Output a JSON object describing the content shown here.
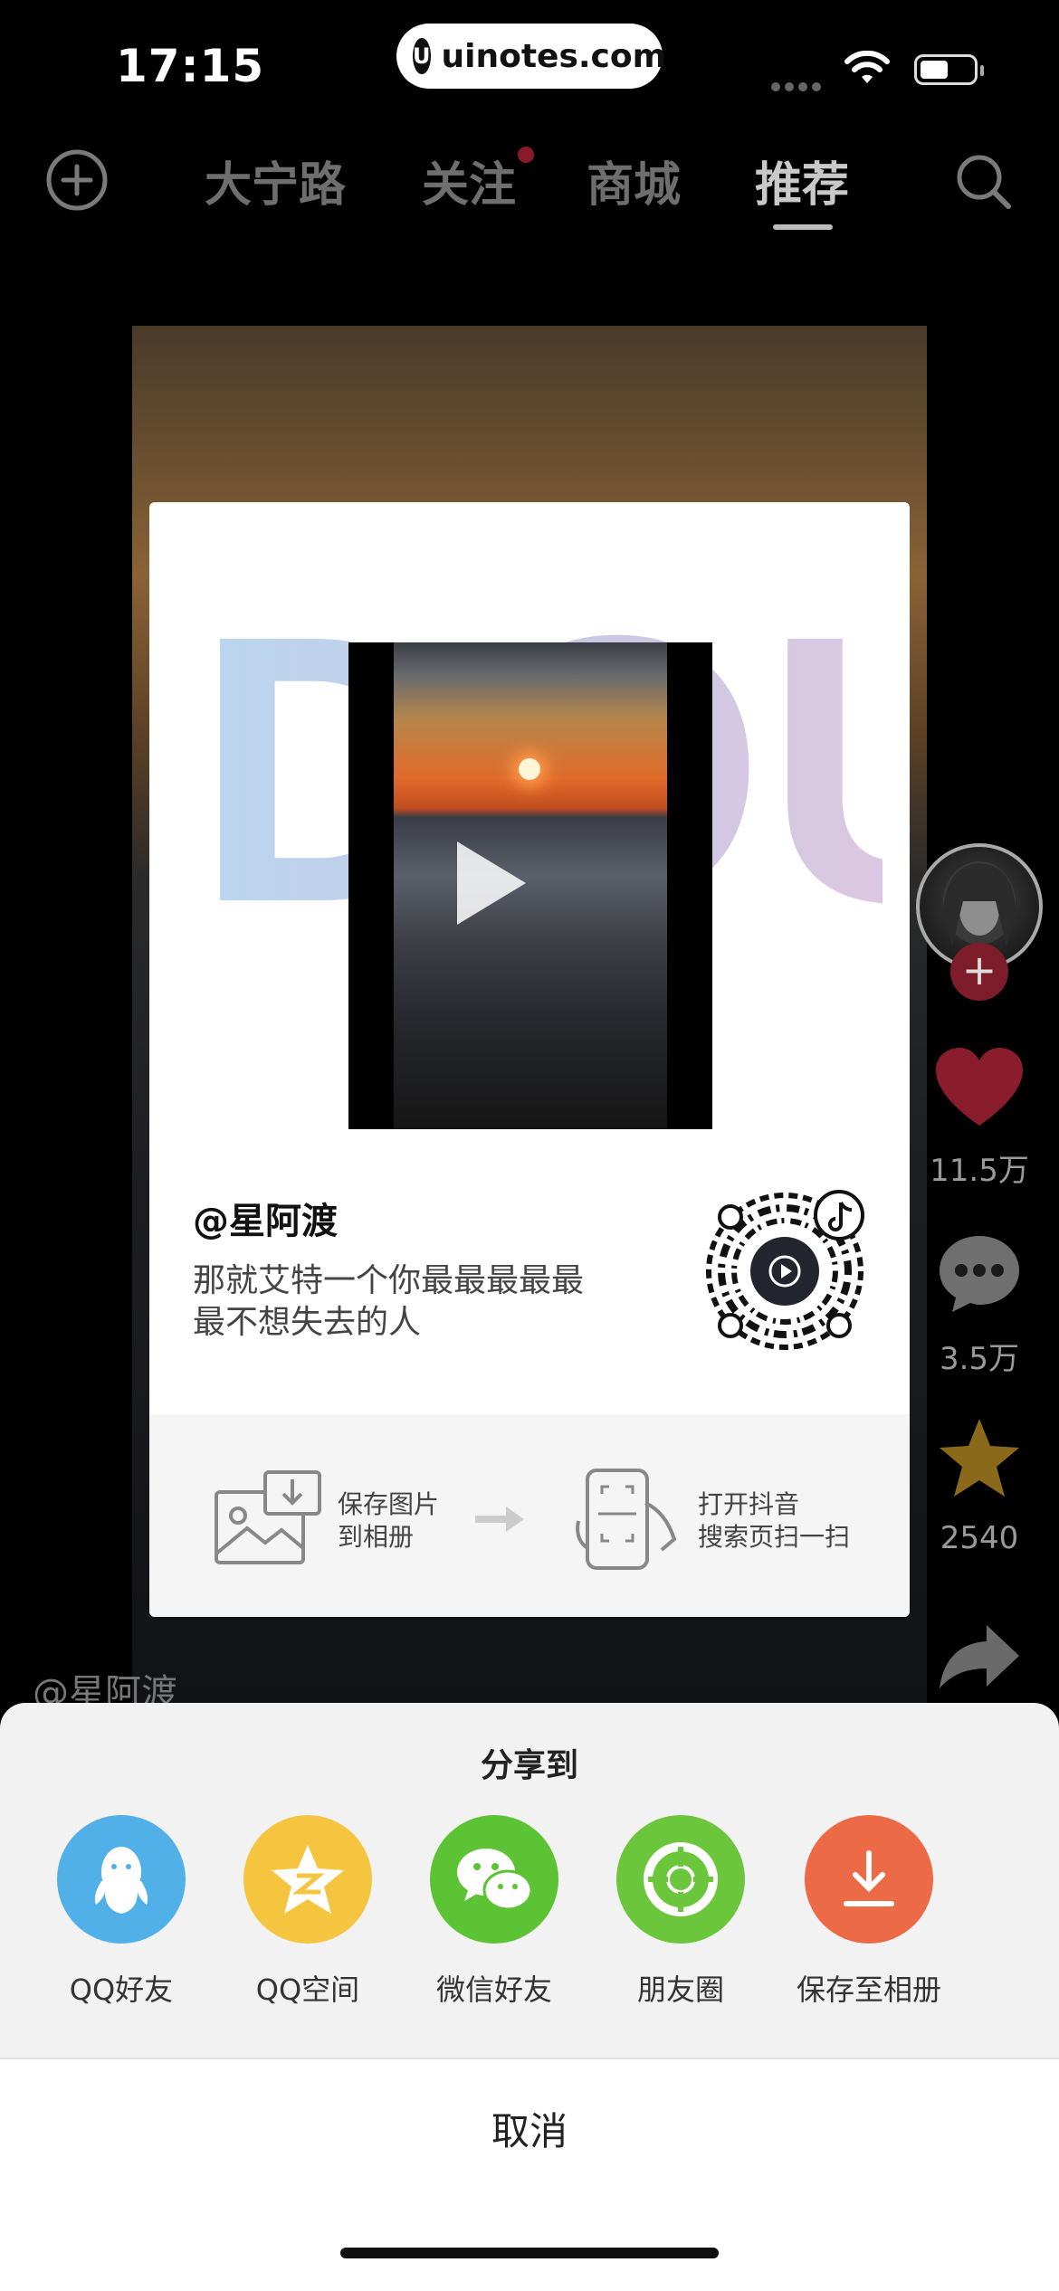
{
  "status_bar": {
    "time": "17:15",
    "url": "uinotes.com",
    "url_logo": "U"
  },
  "top_nav": {
    "tabs": [
      {
        "label": "大宁路",
        "active": false
      },
      {
        "label": "关注",
        "active": false,
        "has_dot": true
      },
      {
        "label": "商城",
        "active": false
      },
      {
        "label": "推荐",
        "active": true
      }
    ]
  },
  "share_card": {
    "brand_text": "DOU",
    "username": "@星阿渡",
    "description_line1": "那就艾特一个你最最最最最",
    "description_line2": "最不想失去的人",
    "step1_line1": "保存图片",
    "step1_line2": "到相册",
    "step2_line1": "打开抖音",
    "step2_line2": "搜索页扫一扫"
  },
  "actions": {
    "likes": "11.5万",
    "comments": "3.5万",
    "favorites": "2540"
  },
  "overlay_user": "@星阿渡",
  "share_sheet": {
    "title": "分享到",
    "targets": [
      {
        "label": "QQ好友",
        "icon": "qq-icon",
        "color": "#52b0e8"
      },
      {
        "label": "QQ空间",
        "icon": "qzone-icon",
        "color": "#f6c540"
      },
      {
        "label": "微信好友",
        "icon": "wechat-icon",
        "color": "#5cc334"
      },
      {
        "label": "朋友圈",
        "icon": "moments-icon",
        "color": "#6cc63b"
      },
      {
        "label": "保存至相册",
        "icon": "download-icon",
        "color": "#ec6a45"
      }
    ],
    "cancel": "取消"
  }
}
